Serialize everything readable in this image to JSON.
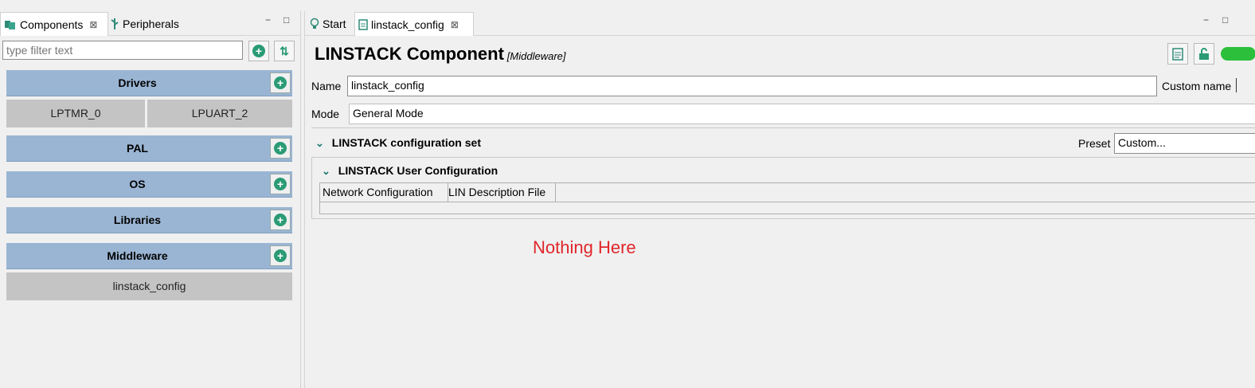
{
  "left_panel": {
    "tabs": [
      {
        "label": "Components",
        "close": "⊠"
      },
      {
        "label": "Peripherals"
      }
    ],
    "window_controls": {
      "minimize": "−",
      "maximize": "□"
    },
    "filter_placeholder": "type filter text",
    "add_symbol": "+",
    "sort_symbol": "⇅",
    "categories": [
      {
        "label": "Drivers",
        "components": [
          "LPTMR_0",
          "LPUART_2"
        ]
      },
      {
        "label": "PAL",
        "components": []
      },
      {
        "label": "OS",
        "components": []
      },
      {
        "label": "Libraries",
        "components": []
      },
      {
        "label": "Middleware",
        "components": [
          "linstack_config"
        ]
      }
    ]
  },
  "editor": {
    "tabs": [
      {
        "label": "Start"
      },
      {
        "label": "linstack_config",
        "close": "⊠"
      }
    ],
    "window_controls": {
      "minimize": "−",
      "maximize": "□"
    },
    "title": "LINSTACK Component",
    "subtitle": "[Middleware]",
    "name_label": "Name",
    "name_value": "linstack_config",
    "custom_name_label": "Custom name",
    "mode_label": "Mode",
    "mode_value": "General Mode",
    "config_set_label": "LINSTACK configuration set",
    "preset_label": "Preset",
    "preset_value": "Custom...",
    "user_config_label": "LINSTACK User Configuration",
    "subtabs": [
      "Network Configuration",
      "LIN Description File"
    ],
    "annotation": "Nothing Here",
    "annotation_color": "#e0262b",
    "chevron": "⌄"
  }
}
